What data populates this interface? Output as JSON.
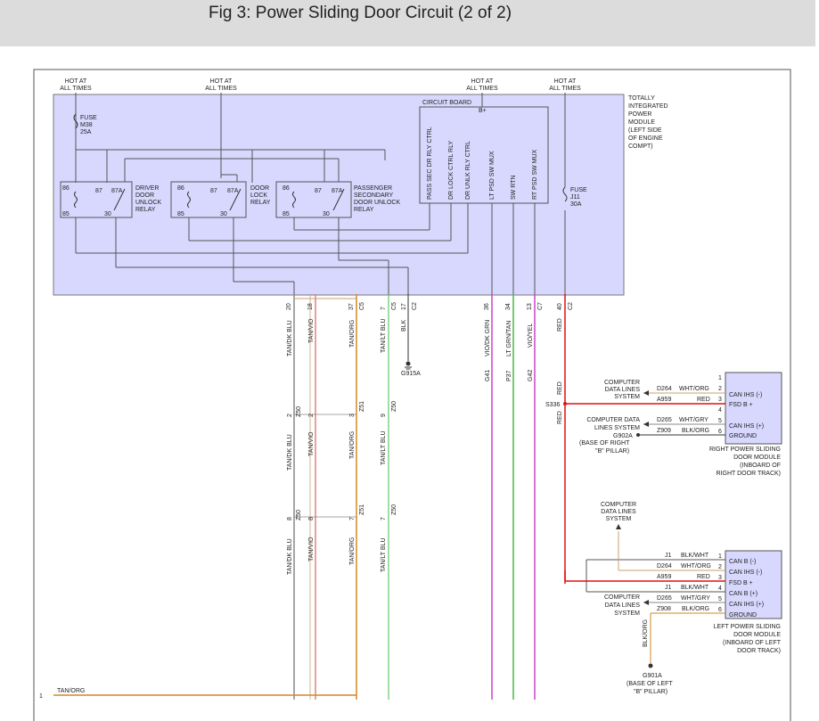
{
  "page": {
    "title": "Fig 3: Power Sliding Door Circuit (2 of 2)"
  },
  "colors": {
    "module_fill": "#d8d8ff",
    "module_border": "#777777",
    "red": "#e01010",
    "magenta": "#cc44cc",
    "green": "#44bb44",
    "orange": "#d08a20",
    "tan": "#c8a070",
    "gray": "#888888"
  },
  "hot": {
    "hot_at": "HOT AT",
    "all_times": "ALL TIMES"
  },
  "fuses": {
    "m38": [
      "FUSE",
      "M38",
      "25A"
    ],
    "j11": [
      "FUSE",
      "J11",
      "30A"
    ]
  },
  "tipm": [
    "TOTALLY",
    "INTEGRATED",
    "POWER",
    "MODULE",
    "(LEFT SIDE",
    "OF ENGINE",
    "COMPT)"
  ],
  "circuit_board": {
    "label": "CIRCUIT BOARD",
    "bplus": "B+"
  },
  "cb_signals": [
    "PASS SEC DR RLY CTRL",
    "DR LOCK CTRL RLY",
    "DR UNLK RLY CTRL",
    "LT PSD SW MUX",
    "SW RTN",
    "RT PSD SW MUX"
  ],
  "relays": {
    "driver": {
      "pins": [
        "86",
        "87",
        "87A",
        "85",
        "30"
      ],
      "label": [
        "DRIVER",
        "DOOR",
        "UNLOCK",
        "RELAY"
      ]
    },
    "lock": {
      "pins": [
        "86",
        "87",
        "87A",
        "85",
        "30"
      ],
      "label": [
        "DOOR",
        "LOCK",
        "RELAY"
      ]
    },
    "pass": {
      "pins": [
        "86",
        "87",
        "87A",
        "85",
        "30"
      ],
      "label": [
        "PASSENGER",
        "SECONDARY",
        "DOOR UNLOCK",
        "RELAY"
      ]
    }
  },
  "connector_pins": {
    "c5_20": "20",
    "c5_18": "18",
    "c5_37": "37",
    "c5": "C5",
    "c5_7": "7",
    "c5b": "C5",
    "c2_17": "17",
    "c2": "C2",
    "c2_36": "36",
    "c2_34": "34",
    "c2_13": "13",
    "c7": "C7",
    "c2_40": "40",
    "c2b": "C2"
  },
  "wires": {
    "tan_dk_blu": "TAN/DK BLU",
    "tan_vio": "TAN/VIO",
    "tan_org": "TAN/ORG",
    "tan_lt_blu": "TAN/LT BLU",
    "blk": "BLK",
    "vio_dk_grn": "VIO/DK GRN",
    "lt_grn_tan": "LT GRN/TAN",
    "vio_yel": "VIO/YEL",
    "red": "RED",
    "g41": "G41",
    "p37": "P37",
    "g42": "G42"
  },
  "ground_top": "G915A",
  "mid_connectors": {
    "p1": "2",
    "p2": "2",
    "p3": "3",
    "p4": "9",
    "c_a": "Z50",
    "c_b": "Z51",
    "c_c": "Z50",
    "q1": "8",
    "q2": "8",
    "q3": "7",
    "q4": "7",
    "c_d": "Z50",
    "c_e": "Z51",
    "c_f": "Z50"
  },
  "right_module": {
    "pins": [
      "1",
      "2",
      "3",
      "4",
      "5",
      "6"
    ],
    "lines": [
      "CAN IHS (-)",
      "FSD B +",
      "CAN IHS (+)",
      "GROUND"
    ],
    "caption": [
      "RIGHT POWER SLIDING",
      "DOOR MODULE",
      "(INBOARD OF",
      "RIGHT DOOR TRACK)"
    ],
    "wires": [
      {
        "circuit": "D264",
        "color": "WHT/ORG"
      },
      {
        "circuit": "A959",
        "color": "RED"
      },
      {
        "circuit": "D265",
        "color": "WHT/GRY"
      },
      {
        "circuit": "Z909",
        "color": "BLK/ORG"
      }
    ],
    "cdl_top": [
      "COMPUTER",
      "DATA LINES",
      "SYSTEM"
    ],
    "cdl_bottom": [
      "COMPUTER DATA",
      "LINES SYSTEM"
    ],
    "ground": "G902A",
    "ground_caption": [
      "(BASE OF RIGHT",
      "\"B\" PILLAR)"
    ],
    "splice": "S336",
    "red": "RED"
  },
  "left_module": {
    "pins": [
      "1",
      "2",
      "3",
      "4",
      "5",
      "6"
    ],
    "lines": [
      "CAN B (-)",
      "CAN IHS (-)",
      "FSD B +",
      "CAN B (+)",
      "CAN IHS (+)",
      "GROUND"
    ],
    "caption": [
      "LEFT POWER SLIDING",
      "DOOR MODULE",
      "(INBOARD OF LEFT",
      "DOOR TRACK)"
    ],
    "wires": [
      {
        "circuit": "J1",
        "color": "BLK/WHT"
      },
      {
        "circuit": "D264",
        "color": "WHT/ORG"
      },
      {
        "circuit": "A959",
        "color": "RED"
      },
      {
        "circuit": "J1",
        "color": "BLK/WHT"
      },
      {
        "circuit": "D265",
        "color": "WHT/GRY"
      },
      {
        "circuit": "Z908",
        "color": "BLK/ORG"
      }
    ],
    "cdl_top": [
      "COMPUTER",
      "DATA LINES",
      "SYSTEM"
    ],
    "cdl_bottom": [
      "COMPUTER",
      "DATA LINES",
      "SYSTEM"
    ],
    "blk_org": "BLK/ORG",
    "ground": "G901A",
    "ground_caption": [
      "(BASE OF LEFT",
      "\"B\" PILLAR)"
    ]
  },
  "bottom": {
    "one": "1",
    "tan_org": "TAN/ORG"
  }
}
